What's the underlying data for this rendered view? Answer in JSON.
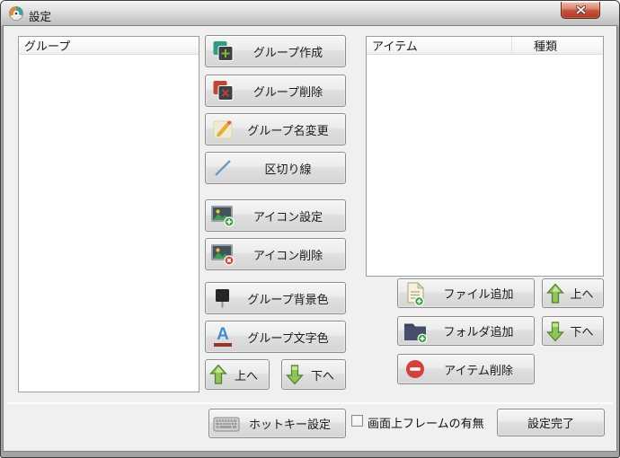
{
  "window": {
    "title": "設定"
  },
  "left_panel": {
    "header": "グループ",
    "rows": []
  },
  "middle_buttons": {
    "create": "グループ作成",
    "delete": "グループ削除",
    "rename": "グループ名変更",
    "separator": "区切り線",
    "icon_set": "アイコン設定",
    "icon_delete": "アイコン削除",
    "bg_color": "グループ背景色",
    "text_color": "グループ文字色",
    "up": "上へ",
    "down": "下へ"
  },
  "right_panel": {
    "columns": {
      "item": "アイテム",
      "type": "種類"
    },
    "rows": []
  },
  "right_buttons": {
    "add_file": "ファイル追加",
    "add_folder": "フォルダ追加",
    "delete_item": "アイテム削除",
    "up": "上へ",
    "down": "下へ"
  },
  "bottom_bar": {
    "hotkey_button": "ホットキー設定",
    "frame_checkbox_label": "画面上フレームの有無",
    "frame_checkbox_checked": false,
    "done_button": "設定完了"
  },
  "icons": {
    "text_color_glyph": "A"
  },
  "colors": {
    "client_bg": "#f0f0f0",
    "accent_teal": "#2e9b85",
    "accent_red": "#c04537",
    "accent_green": "#4f9e2f",
    "accent_blue": "#6f9cc4",
    "folder_navy": "#454e6b"
  }
}
